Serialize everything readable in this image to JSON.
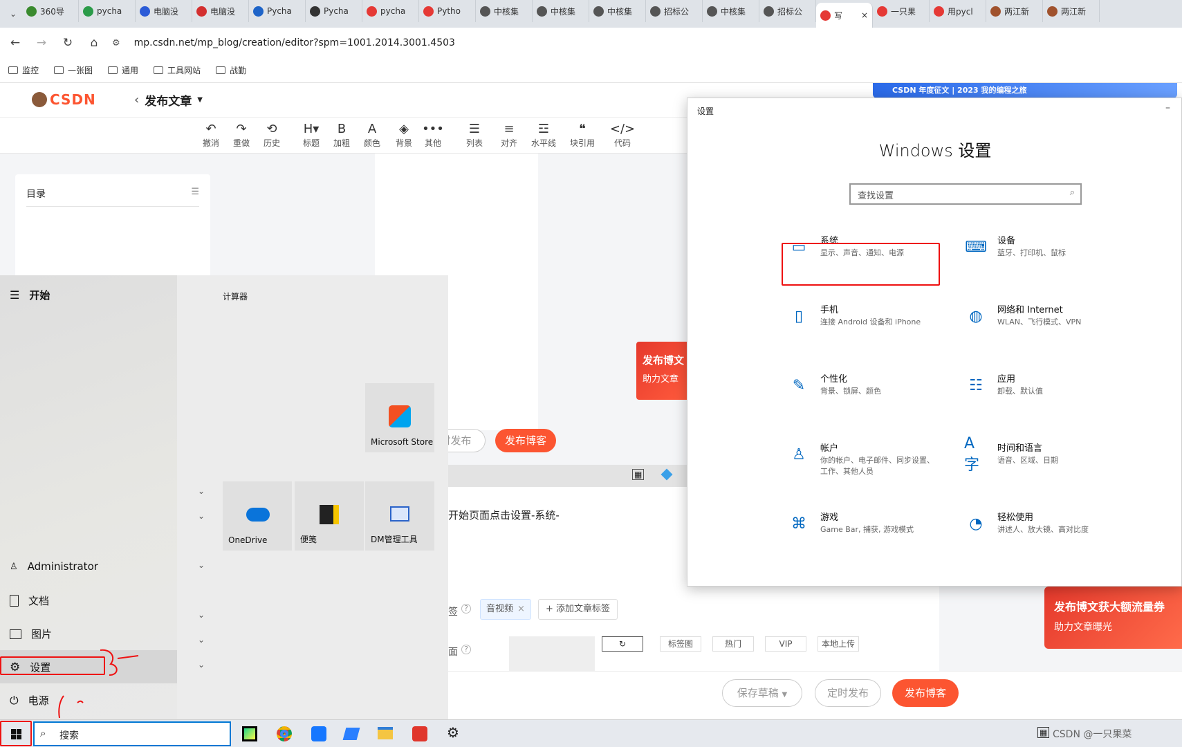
{
  "browser": {
    "tabs": [
      {
        "label": "360导"
      },
      {
        "label": "pycha"
      },
      {
        "label": "电脑没"
      },
      {
        "label": "电脑没"
      },
      {
        "label": "Pycha"
      },
      {
        "label": "Pycha"
      },
      {
        "label": "pycha"
      },
      {
        "label": "Pytho"
      },
      {
        "label": "中核集"
      },
      {
        "label": "中核集"
      },
      {
        "label": "中核集"
      },
      {
        "label": "招标公"
      },
      {
        "label": "中核集"
      },
      {
        "label": "招标公"
      },
      {
        "label": "写"
      },
      {
        "label": "一只果"
      },
      {
        "label": "用pycl"
      },
      {
        "label": "两江新"
      },
      {
        "label": "两江新"
      }
    ],
    "url": "mp.csdn.net/mp_blog/creation/editor?spm=1001.2014.3001.4503",
    "bookmarks": [
      "监控",
      "一张图",
      "通用",
      "工具网站",
      "战勤"
    ]
  },
  "csdn": {
    "logo": "CSDN",
    "page_title": "发布文章",
    "banner": "CSDN 年度征文 | 2023 我的编程之旅",
    "toolbar": [
      {
        "icon": "↶",
        "label": "撤消"
      },
      {
        "icon": "↷",
        "label": "重做"
      },
      {
        "icon": "⟲",
        "label": "历史"
      },
      {
        "icon": "H▾",
        "label": "标题"
      },
      {
        "icon": "B",
        "label": "加粗"
      },
      {
        "icon": "A",
        "label": "颜色"
      },
      {
        "icon": "◈",
        "label": "背景"
      },
      {
        "icon": "•••",
        "label": "其他"
      },
      {
        "icon": "☰",
        "label": "列表"
      },
      {
        "icon": "≡",
        "label": "对齐"
      },
      {
        "icon": "☲",
        "label": "水平线"
      },
      {
        "icon": "❝",
        "label": "块引用"
      },
      {
        "icon": "</>",
        "label": "代码"
      }
    ],
    "toc_title": "目录",
    "promo_title": "发布博文",
    "promo_sub": "助力文章",
    "promo2_title": "发布博文获大额流量券",
    "promo2_sub": "助力文章曝光",
    "schedule_btn": "定时发布",
    "publish_btn": "发布博客",
    "body_text": "开始页面点击设置-系统-",
    "tag_label": "签",
    "tag": "音视频",
    "add_tag": "添加文章标签",
    "cover_label": "面",
    "cover_tabs": [
      "标签图",
      "热门",
      "VIP",
      "本地上传"
    ],
    "save_draft": "保存草稿",
    "bottom_schedule": "定时发布",
    "bottom_publish": "发布博客"
  },
  "start_menu": {
    "title": "开始",
    "recent_title": "计算器",
    "items": [
      {
        "label": "Administrator"
      },
      {
        "label": "文档"
      },
      {
        "label": "图片"
      },
      {
        "label": "设置"
      },
      {
        "label": "电源"
      }
    ],
    "tiles": [
      {
        "label": "Microsoft Store"
      },
      {
        "label": "OneDrive"
      },
      {
        "label": "便笺"
      },
      {
        "label": "DM管理工具"
      }
    ]
  },
  "taskbar": {
    "search_placeholder": "搜索",
    "tray_text": "CSDN @一只果菜"
  },
  "settings": {
    "window_title": "设置",
    "heading": "Windows 设置",
    "search_placeholder": "查找设置",
    "items": [
      {
        "title": "系统",
        "desc": "显示、声音、通知、电源",
        "icon": "laptop-icon"
      },
      {
        "title": "设备",
        "desc": "蓝牙、打印机、鼠标",
        "icon": "keyboard-icon"
      },
      {
        "title": "手机",
        "desc": "连接 Android 设备和 iPhone",
        "icon": "phone-icon"
      },
      {
        "title": "网络和 Internet",
        "desc": "WLAN、飞行模式、VPN",
        "icon": "globe-icon"
      },
      {
        "title": "个性化",
        "desc": "背景、锁屏、颜色",
        "icon": "paint-icon"
      },
      {
        "title": "应用",
        "desc": "卸载、默认值",
        "icon": "apps-icon"
      },
      {
        "title": "帐户",
        "desc": "你的帐户、电子邮件、同步设置、工作、其他人员",
        "icon": "person-icon"
      },
      {
        "title": "时间和语言",
        "desc": "语音、区域、日期",
        "icon": "language-icon"
      },
      {
        "title": "游戏",
        "desc": "Game Bar, 捕获, 游戏模式",
        "icon": "gamepad-icon"
      },
      {
        "title": "轻松使用",
        "desc": "讲述人、放大镜、高对比度",
        "icon": "accessibility-icon"
      }
    ]
  },
  "colors": {
    "accent": "#0067c0",
    "csdn_red": "#fc5531",
    "annotation": "#e11111"
  }
}
